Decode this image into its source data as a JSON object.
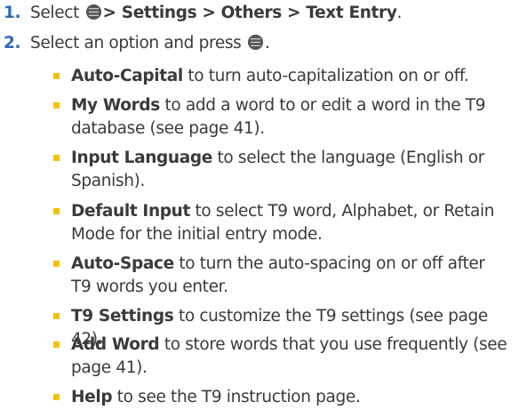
{
  "steps": [
    {
      "number": "1.",
      "prefix": "Select",
      "icon": "menu-ok-key-icon",
      "path": "> Settings > Others > Text Entry",
      "suffix": "."
    },
    {
      "number": "2.",
      "prefix": "Select an option and press",
      "icon": "menu-ok-key-icon",
      "suffix": "."
    }
  ],
  "options": [
    {
      "term": "Auto-Capital",
      "desc": "to turn auto-capitalization on or off."
    },
    {
      "term": "My Words",
      "desc": "to add a word to or edit a word in the T9 database (see page 41)."
    },
    {
      "term": "Input Language",
      "desc": "to select the language (English or Spanish)."
    },
    {
      "term": "Default Input",
      "desc": "to select T9 word, Alphabet, or Retain Mode for the initial entry mode."
    },
    {
      "term": "Auto-Space",
      "desc": "to turn the auto-spacing on or off after T9 words you enter."
    },
    {
      "term": "T9 Settings",
      "desc": "to customize the T9 settings (see page 42)."
    },
    {
      "term": "Add Word",
      "desc": "to store words that you use frequently (see page 41)."
    },
    {
      "term": "Help",
      "desc": "to see the T9 instruction page."
    }
  ],
  "colors": {
    "step_number": "#2b6cb5",
    "bullet": "#f2c200",
    "text": "#3a3a3a"
  }
}
